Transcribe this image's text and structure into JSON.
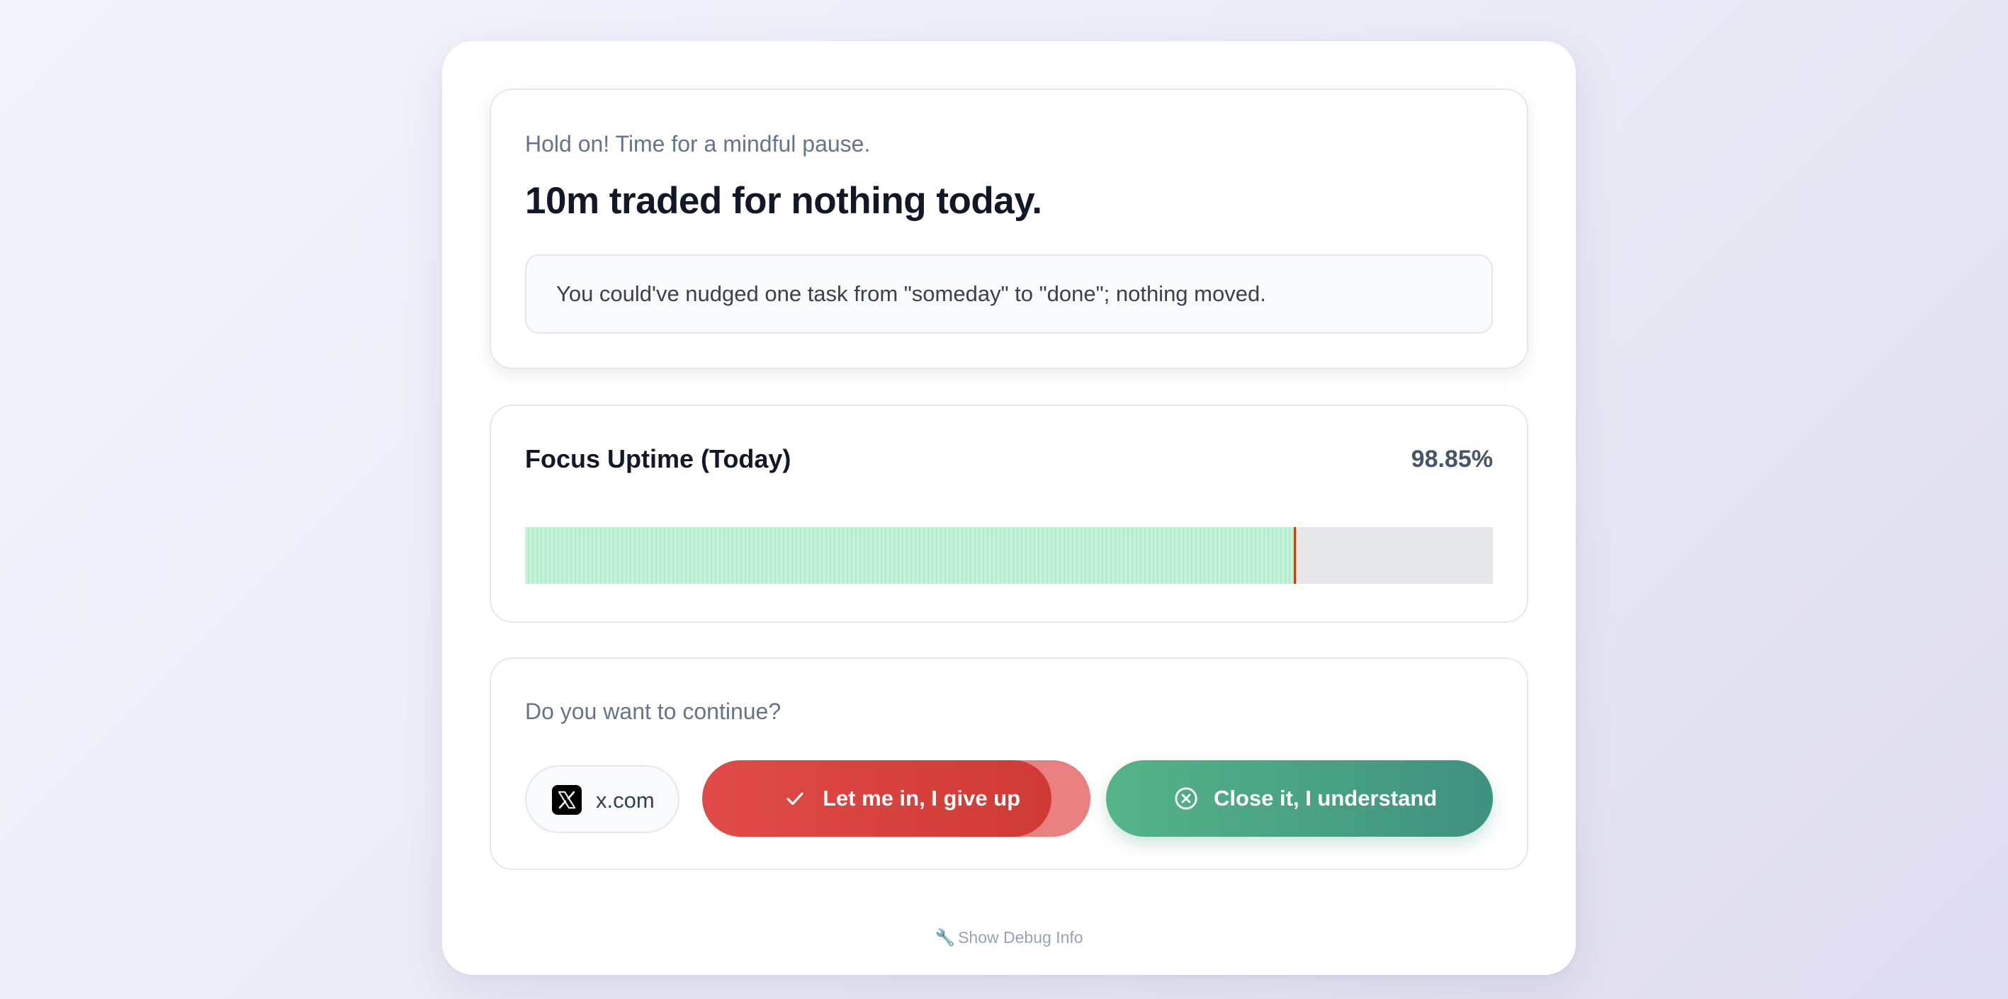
{
  "hero": {
    "subtitle": "Hold on! Time for a mindful pause.",
    "title": "10m traded for nothing today.",
    "message": "You could've nudged one task from \"someday\" to \"done\"; nothing moved."
  },
  "uptime": {
    "label": "Focus Uptime (Today)",
    "value_text": "98.85%",
    "timeline_progress": 0.794,
    "colors": {
      "focus": "#b8f0d0",
      "distraction": "#c2410c",
      "empty": "#e5e7eb"
    }
  },
  "prompt": {
    "question": "Do you want to continue?",
    "site": {
      "name": "x.com",
      "icon": "x-logo-icon"
    },
    "giveup_button": {
      "label": "Let me in, I give up",
      "icon": "check-icon",
      "hold_progress": 0.9,
      "color": "#d9423f"
    },
    "close_button": {
      "label": "Close it, I understand",
      "icon": "x-circle-icon",
      "color": "#4aa383"
    }
  },
  "debug": {
    "icon": "wrench-icon",
    "icon_glyph": "🔧",
    "label": "Show Debug Info"
  }
}
